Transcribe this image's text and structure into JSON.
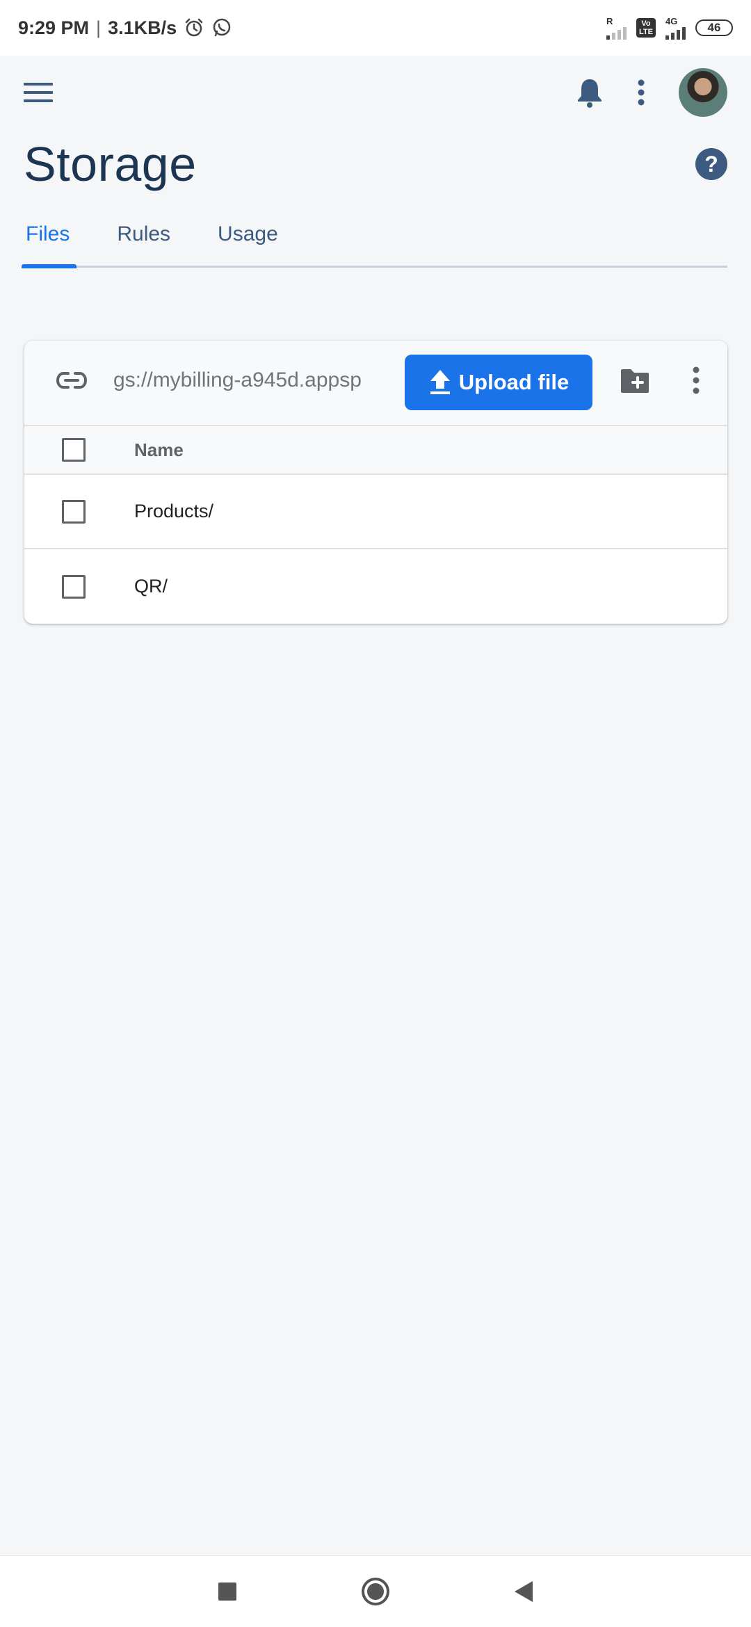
{
  "status_bar": {
    "time": "9:29 PM",
    "separator": "|",
    "net_speed": "3.1KB/s",
    "signal1_label": "R",
    "volte_label_top": "Vo",
    "volte_label_bottom": "LTE",
    "signal2_label": "4G",
    "battery": "46",
    "icons": [
      "alarm-icon",
      "whatsapp-icon"
    ]
  },
  "appbar": {
    "icons": [
      "menu-icon",
      "bell-icon",
      "more-vert-icon",
      "avatar"
    ]
  },
  "page": {
    "title": "Storage",
    "help_label": "?"
  },
  "tabs": [
    {
      "label": "Files",
      "active": true
    },
    {
      "label": "Rules",
      "active": false
    },
    {
      "label": "Usage",
      "active": false
    }
  ],
  "files_card": {
    "bucket_path": "gs://mybilling-a945d.appsp",
    "upload_label": "Upload file",
    "column_name": "Name",
    "items": [
      {
        "name": "Products/"
      },
      {
        "name": "QR/"
      }
    ]
  },
  "colors": {
    "accent": "#1a73e8",
    "title": "#1c3553",
    "background": "#f4f6f8"
  }
}
